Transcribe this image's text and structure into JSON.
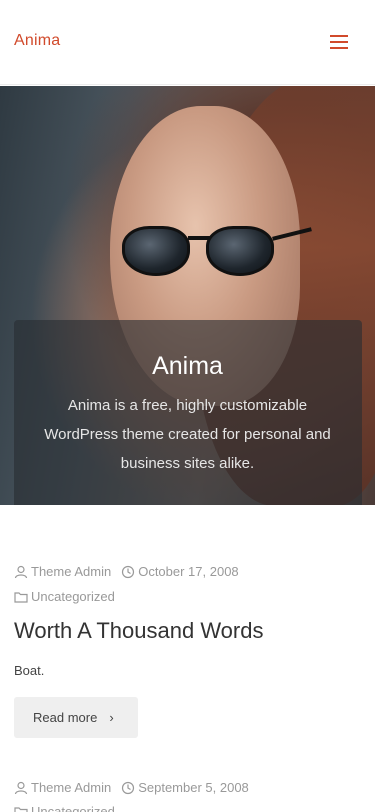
{
  "site": {
    "title": "Anima",
    "menu_icon": "hamburger-icon",
    "accent": "#d14a2b"
  },
  "hero": {
    "title": "Anima",
    "description": "Anima is a free, highly customizable WordPress theme created for personal and business sites alike."
  },
  "posts": [
    {
      "author": "Theme Admin",
      "date": "October 17, 2008",
      "category": "Uncategorized",
      "title": "Worth A Thousand Words",
      "excerpt": "Boat.",
      "read_more": "Read more"
    },
    {
      "author": "Theme Admin",
      "date": "September 5, 2008",
      "category": "Uncategorized"
    }
  ]
}
